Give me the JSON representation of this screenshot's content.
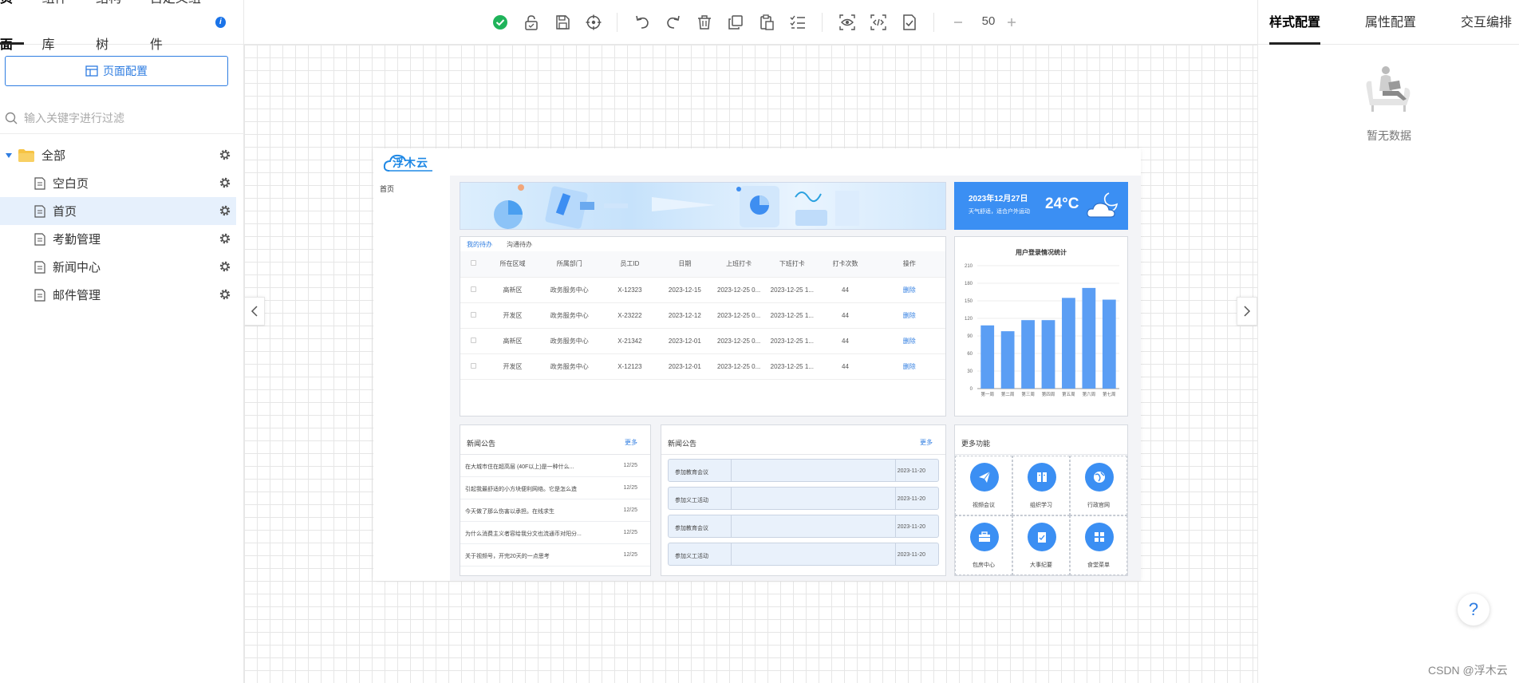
{
  "left_panel": {
    "tabs": [
      "页面",
      "组件库",
      "结构树",
      "自定义组件"
    ],
    "page_config_label": "页面配置",
    "filter_placeholder": "输入关键字进行过滤",
    "tree": {
      "root_label": "全部",
      "children": [
        "空白页",
        "首页",
        "考勤管理",
        "新闻中心",
        "邮件管理"
      ],
      "selected": "首页"
    }
  },
  "toolbar": {
    "zoom": "50",
    "icons": [
      "check-circle-icon",
      "unlock-icon",
      "save-icon",
      "target-icon",
      "undo-icon",
      "redo-icon",
      "delete-icon",
      "copy-icon",
      "paste-icon",
      "list-check-icon",
      "preview-eye-icon",
      "code-icon",
      "file-check-icon",
      "zoom-out-icon",
      "zoom-in-icon"
    ]
  },
  "preview": {
    "logo": "浮木云",
    "nav_item": "首页",
    "weather": {
      "date": "2023年12月27日",
      "desc": "天气舒适，适合户外运动",
      "temp": "24°C"
    },
    "table": {
      "tabs": [
        "我的待办",
        "沟通待办"
      ],
      "headers": [
        "",
        "所在区域",
        "所属部门",
        "员工ID",
        "日期",
        "上班打卡",
        "下班打卡",
        "打卡次数",
        "操作"
      ],
      "rows": [
        [
          "",
          "高新区",
          "政务服务中心",
          "X-12323",
          "2023-12-15",
          "2023-12-25 0...",
          "2023-12-25 1...",
          "44",
          "删除"
        ],
        [
          "",
          "开发区",
          "政务服务中心",
          "X-23222",
          "2023-12-12",
          "2023-12-25 0...",
          "2023-12-25 1...",
          "44",
          "删除"
        ],
        [
          "",
          "高新区",
          "政务服务中心",
          "X-21342",
          "2023-12-01",
          "2023-12-25 0...",
          "2023-12-25 1...",
          "44",
          "删除"
        ],
        [
          "",
          "开发区",
          "政务服务中心",
          "X-12123",
          "2023-12-01",
          "2023-12-25 0...",
          "2023-12-25 1...",
          "44",
          "删除"
        ]
      ]
    },
    "chart_title": "用户登录情况统计",
    "news": {
      "title": "新闻公告",
      "more": "更多",
      "items": [
        {
          "text": "在大城市住在超高层 (40F以上)是一种什么...",
          "date": "12/25"
        },
        {
          "text": "引起我最舒适的小方块便利网络。它是怎么造",
          "date": "12/25"
        },
        {
          "text": "今天做了那么伤害以承担。在线求生",
          "date": "12/25"
        },
        {
          "text": "为什么消费主义者容给我分文也流通币对阳分...",
          "date": "12/25"
        },
        {
          "text": "关于视频号，开完20天的一点思考",
          "date": "12/25"
        }
      ]
    },
    "notice": {
      "title": "新闻公告",
      "more": "更多",
      "items": [
        {
          "text": "参加教育会议",
          "date": "2023-11-20"
        },
        {
          "text": "参加义工活动",
          "date": "2023-11-20"
        },
        {
          "text": "参加教育会议",
          "date": "2023-11-20"
        },
        {
          "text": "参加义工活动",
          "date": "2023-11-20"
        }
      ]
    },
    "functions": {
      "title": "更多功能",
      "items": [
        {
          "label": "视频会议",
          "icon": "send-icon"
        },
        {
          "label": "组织学习",
          "icon": "book-icon"
        },
        {
          "label": "行政官网",
          "icon": "globe-icon"
        },
        {
          "label": "包房中心",
          "icon": "briefcase-icon"
        },
        {
          "label": "大事纪要",
          "icon": "clipboard-icon"
        },
        {
          "label": "食堂菜单",
          "icon": "grid-icon"
        }
      ]
    }
  },
  "chart_data": {
    "type": "bar",
    "title": "用户登录情况统计",
    "categories": [
      "第一周",
      "第二周",
      "第三周",
      "第四周",
      "第五周",
      "第六周",
      "第七周"
    ],
    "values": [
      108,
      98,
      117,
      117,
      155,
      172,
      152
    ],
    "ylim": [
      0,
      210
    ],
    "yticks": [
      0,
      30,
      60,
      90,
      120,
      150,
      180,
      210
    ],
    "color": "#5b9ef4",
    "grid": true
  },
  "right_panel": {
    "tabs": [
      "样式配置",
      "属性配置",
      "交互编排"
    ],
    "empty_text": "暂无数据"
  },
  "watermark": "CSDN @浮木云"
}
